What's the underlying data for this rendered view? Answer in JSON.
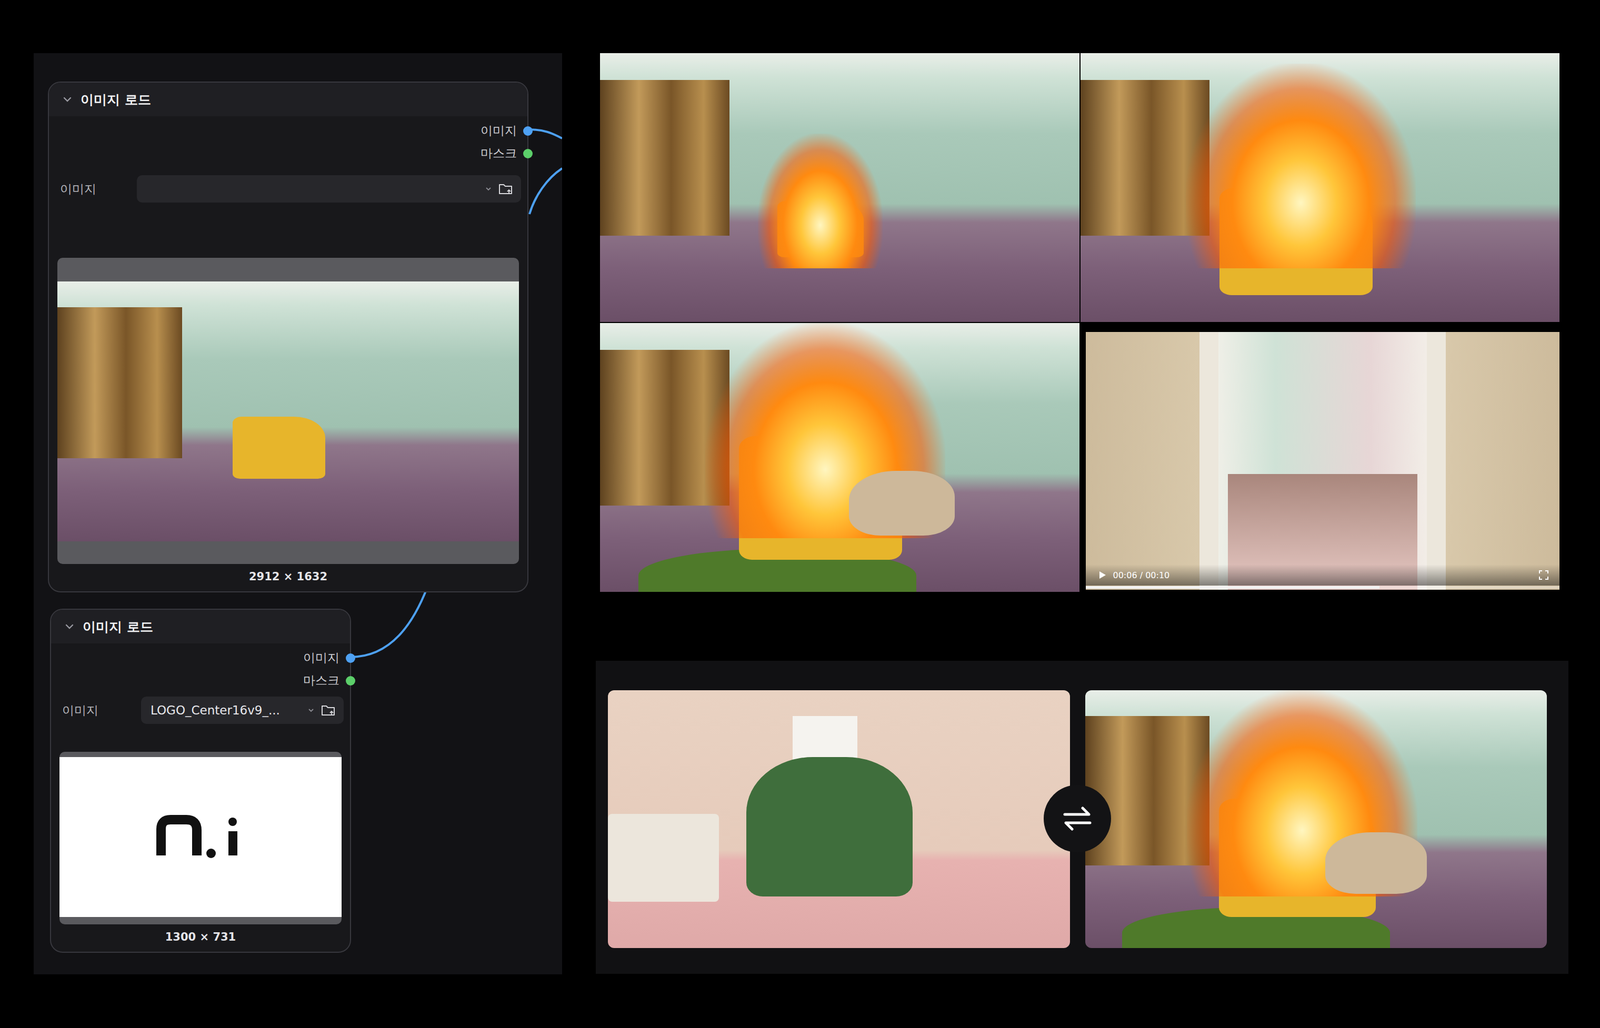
{
  "canvas": {
    "nodes": [
      {
        "title": "이미지 로드",
        "expanded": true,
        "outputs": [
          {
            "label": "이미지",
            "color": "#4ea1f3"
          },
          {
            "label": "마스크",
            "color": "#5ccf6a"
          }
        ],
        "widget": {
          "label": "이미지",
          "value": ""
        },
        "preview": {
          "kind": "photo",
          "caption": "2912 × 1632"
        }
      },
      {
        "title": "이미지 로드",
        "expanded": true,
        "outputs": [
          {
            "label": "이미지",
            "color": "#4ea1f3"
          },
          {
            "label": "마스크",
            "color": "#5ccf6a"
          }
        ],
        "widget": {
          "label": "이미지",
          "value": "LOGO_Center16v9_..."
        },
        "preview": {
          "kind": "logo",
          "caption": "1300 × 731"
        }
      }
    ]
  },
  "gallery": [
    {
      "kind": "image"
    },
    {
      "kind": "image"
    },
    {
      "kind": "image"
    },
    {
      "kind": "video",
      "playing": false,
      "time": "00:06 / 00:10",
      "level": 0.62
    }
  ],
  "comparison": [
    {
      "kind": "image"
    },
    {
      "kind": "image"
    }
  ]
}
